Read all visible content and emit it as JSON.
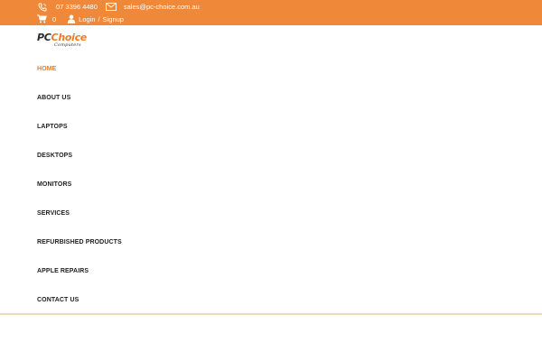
{
  "topbar": {
    "phone": "07 3396 4480",
    "email": "sales@pc-choice.com.au",
    "cart_count": "0",
    "login_label": "Login",
    "separator": "/",
    "signup_label": "Signup",
    "icons": [
      "phone-icon",
      "mail-icon",
      "cart-icon",
      "user-icon"
    ],
    "background_color": "#f0883a"
  },
  "logo": {
    "part1": "PC",
    "part2": "Choice",
    "tagline": "Computers"
  },
  "nav": {
    "active_color": "#f07b26",
    "items": [
      {
        "label": "HOME",
        "active": true
      },
      {
        "label": "ABOUT US",
        "active": false
      },
      {
        "label": "LAPTOPS",
        "active": false
      },
      {
        "label": "DESKTOPS",
        "active": false
      },
      {
        "label": "MONITORS",
        "active": false
      },
      {
        "label": "SERVICES",
        "active": false
      },
      {
        "label": "REFURBISHED PRODUCTS",
        "active": false
      },
      {
        "label": "APPLE REPAIRS",
        "active": false
      },
      {
        "label": "CONTACT US",
        "active": false
      }
    ]
  }
}
